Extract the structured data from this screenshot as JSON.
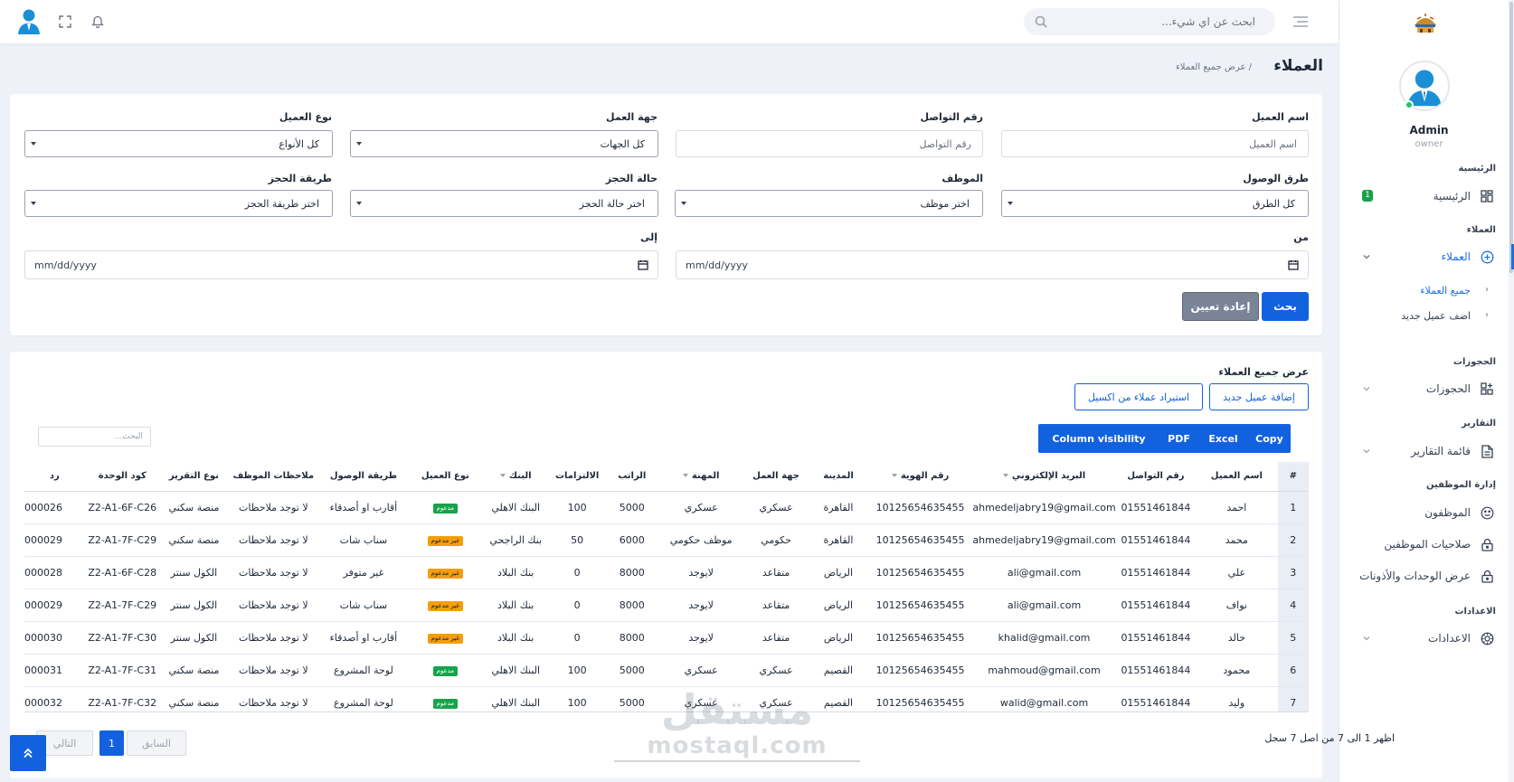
{
  "sidebar": {
    "user_name": "Admin",
    "user_role": "owner",
    "sections": {
      "home": "الرئيسية",
      "clients": "العملاء",
      "bookings": "الحجوزات",
      "reports": "التقارير",
      "staff": "إدارة الموظفين",
      "settings": "الاعدادات"
    },
    "items": {
      "home": {
        "label": "الرئيسية",
        "badge": "1",
        "icon": "dashboard-icon"
      },
      "clients": {
        "label": "العملاء",
        "icon": "plus-circle-icon"
      },
      "all_clients": "جميع العملاء",
      "add_client": "اضف عميل جديد",
      "bookings": {
        "label": "الحجوزات",
        "icon": "grid-plus-icon"
      },
      "reports": {
        "label": "قائمة التقارير",
        "icon": "document-icon"
      },
      "employees": {
        "label": "الموظفون",
        "icon": "smiley-icon"
      },
      "permissions": {
        "label": "صلاحيات الموظفين",
        "icon": "lock-icon"
      },
      "units": {
        "label": "عرض الوحدات والأذونات",
        "icon": "lock-icon"
      },
      "settings": {
        "label": "الاعدادات",
        "icon": "gear-icon"
      }
    }
  },
  "topbar": {
    "search_placeholder": "ابحث عن اي شيء..."
  },
  "page": {
    "title": "العملاء",
    "breadcrumb": "/ عرض جميع العملاء"
  },
  "filters": {
    "client_name": {
      "label": "اسم العميل",
      "placeholder": "اسم العميل"
    },
    "contact": {
      "label": "رقم التواصل",
      "placeholder": "رقم التواصل"
    },
    "work_place": {
      "label": "جهة العمل",
      "value": "كل الجهات"
    },
    "client_type": {
      "label": "نوع العميل",
      "value": "كل الأنواع"
    },
    "arrival": {
      "label": "طرق الوصول",
      "value": "كل الطرق"
    },
    "employee": {
      "label": "الموظف",
      "value": "اختر موظف"
    },
    "booking_status": {
      "label": "حالة الحجز",
      "value": "اختر حالة الحجز"
    },
    "booking_method": {
      "label": "طريقة الحجز",
      "value": "اختر طريقة الحجز"
    },
    "from": {
      "label": "من",
      "value": "mm/dd/yyyy"
    },
    "to": {
      "label": "إلى",
      "value": "mm/dd/yyyy"
    },
    "search_button": "بحث",
    "reset_button": "إعادة تعيين"
  },
  "table_card": {
    "title": "عرض جميع العملاء",
    "add_button": "إضافة عميل جديد",
    "import_button": "استيراد عملاء من اكسيل",
    "export_buttons": [
      "Copy",
      "Excel",
      "PDF",
      "Column visibility"
    ],
    "search_placeholder": "البحث...",
    "columns": [
      "#",
      "اسم العميل",
      "رقم التواصل",
      "البريد الإلكتروني",
      "رقم الهوية",
      "المدينة",
      "جهة العمل",
      "المهنة",
      "الراتب",
      "الالتزامات",
      "البنك",
      "نوع العميل",
      "طريقة الوصول",
      "ملاحظات الموظف",
      "نوع التقرير",
      "كود الوحدة",
      "رد"
    ],
    "rows": [
      [
        "1",
        "احمد",
        "01551461844",
        "ahmedeljabry19@gmail.com",
        "10125654635455",
        "القاهرة",
        "عسكري",
        "عسكري",
        "5000",
        "100",
        "البنك الاهلي",
        "مدعوم",
        "أقارب او أصدقاء",
        "لا توجد ملاحظات",
        "منصة سكني",
        "Z2-A1-6F-C26",
        "000026"
      ],
      [
        "2",
        "محمد",
        "01551461844",
        "ahmedeljabry19@gmail.com",
        "10125654635455",
        "القاهرة",
        "حكومي",
        "موظف حكومي",
        "6000",
        "50",
        "بنك الراجحي",
        "غير مدعوم",
        "سناب شات",
        "لا توجد ملاحظات",
        "منصة سكني",
        "Z2-A1-7F-C29",
        "000029"
      ],
      [
        "3",
        "علي",
        "01551461844",
        "ali@gmail.com",
        "10125654635455",
        "الرياض",
        "متقاعد",
        "لايوجد",
        "8000",
        "0",
        "بنك البلاد",
        "غير مدعوم",
        "غير متوفر",
        "لا توجد ملاحظات",
        "الكول سنتر",
        "Z2-A1-6F-C28",
        "000028"
      ],
      [
        "4",
        "نواف",
        "01551461844",
        "ali@gmail.com",
        "10125654635455",
        "الرياض",
        "متقاعد",
        "لايوجد",
        "8000",
        "0",
        "بنك البلاد",
        "غير مدعوم",
        "سناب شات",
        "لا توجد ملاحظات",
        "الكول سنتر",
        "Z2-A1-7F-C29",
        "000029"
      ],
      [
        "5",
        "خالد",
        "01551461844",
        "khalid@gmail.com",
        "10125654635455",
        "الرياض",
        "متقاعد",
        "لايوجد",
        "8000",
        "0",
        "بنك البلاد",
        "غير مدعوم",
        "أقارب او أصدقاء",
        "لا توجد ملاحظات",
        "الكول سنتر",
        "Z2-A1-7F-C30",
        "000030"
      ],
      [
        "6",
        "محمود",
        "01551461844",
        "mahmoud@gmail.com",
        "10125654635455",
        "القصيم",
        "عسكري",
        "عسكري",
        "5000",
        "100",
        "البنك الاهلي",
        "مدعوم",
        "لوحة المشروع",
        "لا توجد ملاحظات",
        "منصة سكني",
        "Z2-A1-7F-C31",
        "000031"
      ],
      [
        "7",
        "وليد",
        "01551461844",
        "walid@gmail.com",
        "10125654635455",
        "القصيم",
        "عسكري",
        "عسكري",
        "5000",
        "100",
        "البنك الاهلي",
        "مدعوم",
        "لوحة المشروع",
        "لا توجد ملاحظات",
        "منصة سكني",
        "Z2-A1-7F-C32",
        "000032"
      ]
    ],
    "info": "اظهر 1 الى 7 من اصل 7 سجل",
    "pagination": {
      "prev": "السابق",
      "current": "1",
      "next": "التالي"
    }
  },
  "watermark": {
    "arabic": "مستقل",
    "latin": "mostaql.com"
  },
  "colors": {
    "primary": "#1262e0",
    "supported": "#16a34a",
    "unsupported": "#f59e0b"
  }
}
